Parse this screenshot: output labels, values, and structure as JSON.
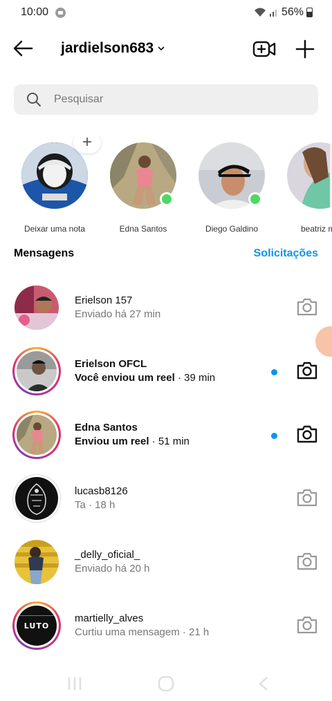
{
  "status_bar": {
    "time": "10:00",
    "battery": "56%"
  },
  "header": {
    "username": "jardielson683"
  },
  "search": {
    "placeholder": "Pesquisar"
  },
  "stories": [
    {
      "label": "Deixar uma nota",
      "online": false
    },
    {
      "label": "Edna Santos",
      "online": true
    },
    {
      "label": "Diego Galdino",
      "online": true
    },
    {
      "label": "beatriz ma",
      "online": false
    }
  ],
  "section": {
    "title": "Mensagens",
    "requests": "Solicitações"
  },
  "threads": [
    {
      "name": "Erielson 157",
      "subtitle": "Enviado há 27 min",
      "time": "",
      "unread": false,
      "ring": false
    },
    {
      "name": "Erielson OFCL",
      "subtitle": "Você enviou um reel",
      "time": " · 39 min",
      "unread": true,
      "ring": true
    },
    {
      "name": "Edna Santos",
      "subtitle": "Enviou um reel",
      "time": " · 51 min",
      "unread": true,
      "ring": true
    },
    {
      "name": "lucasb8126",
      "subtitle": "Ta · 18 h",
      "time": "",
      "unread": false,
      "ring": false
    },
    {
      "name": "_delly_oficial_",
      "subtitle": "Enviado há 20 h",
      "time": "",
      "unread": false,
      "ring": false
    },
    {
      "name": "martielly_alves",
      "subtitle": "Curtiu uma mensagem · 21 h",
      "time": "",
      "unread": false,
      "ring": true,
      "avatar_text": "LUTO"
    }
  ],
  "colors": {
    "accent": "#0a95f0",
    "online": "#4cd964",
    "unread_dot": "#0a95f0"
  },
  "icons": {
    "back": "arrow-left-icon",
    "dropdown": "chevron-down-icon",
    "video": "video-add-icon",
    "new": "plus-icon",
    "search": "search-icon",
    "camera": "camera-icon"
  }
}
